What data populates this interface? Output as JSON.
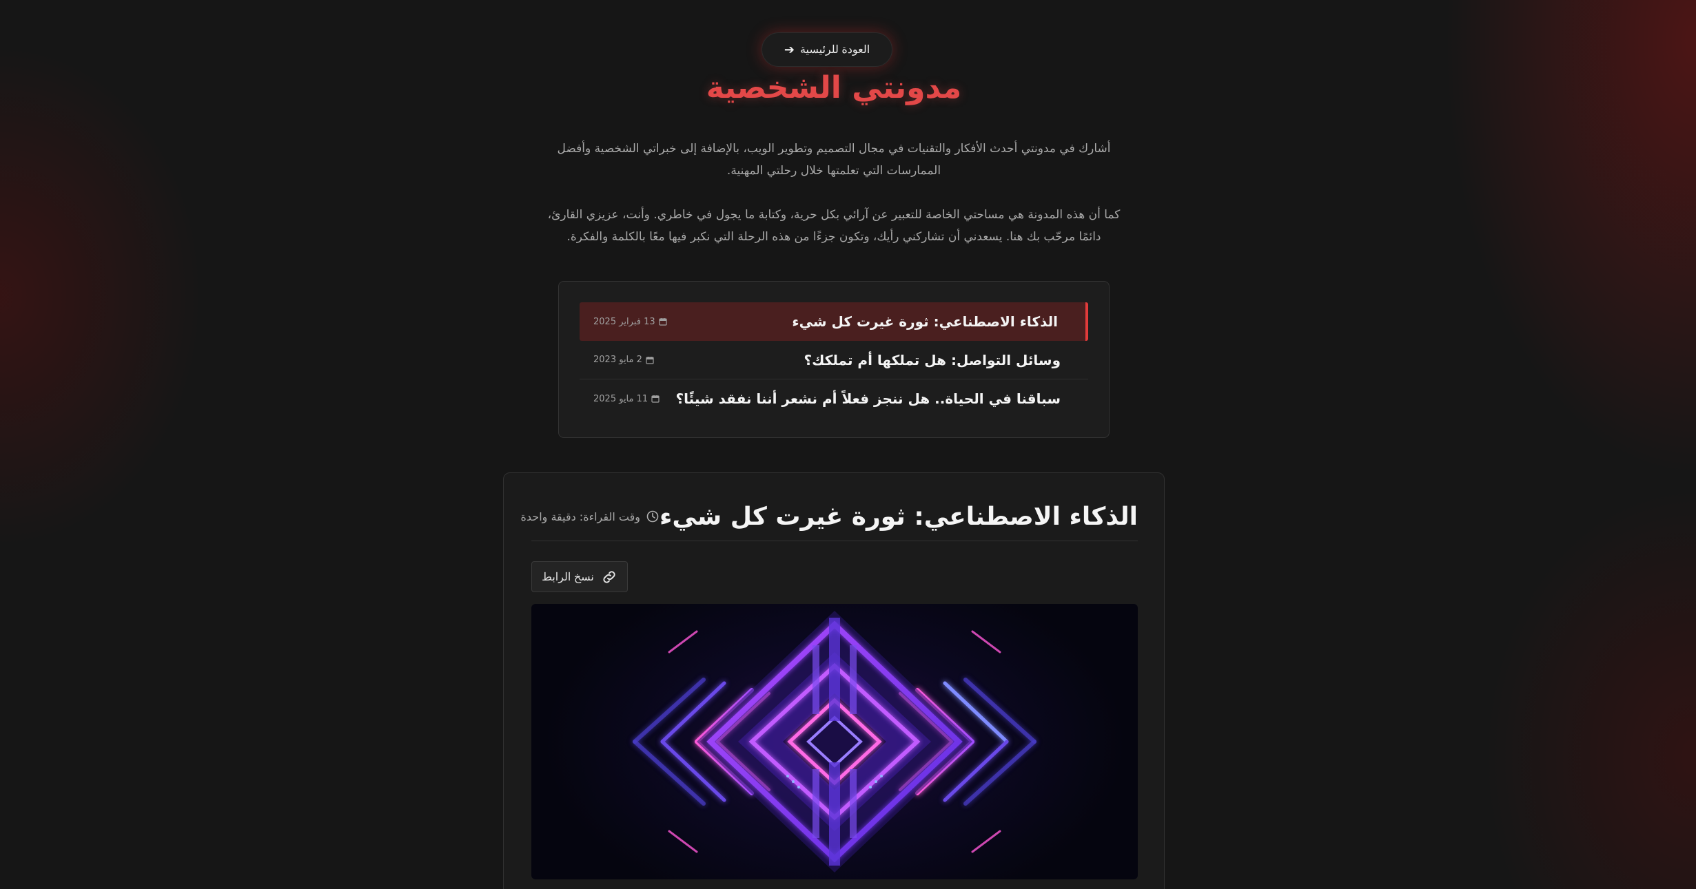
{
  "header": {
    "back_button_label": "العودة للرئيسية",
    "site_title": "مدونتي الشخصية",
    "intro_paragraph_1": "أشارك في مدونتي أحدث الأفكار والتقنيات في مجال التصميم وتطوير الويب، بالإضافة إلى خبراتي الشخصية وأفضل الممارسات التي تعلمتها خلال رحلتي المهنية.",
    "intro_paragraph_2": "كما أن هذه المدونة هي مساحتي الخاصة للتعبير عن آرائي بكل حرية، وكتابة ما يجول في خاطري. وأنت، عزيزي القارئ، دائمًا مرحّب بك هنا. يسعدني أن تشاركني رأيك، وتكون جزءًا من هذه الرحلة التي نكبر فيها معًا بالكلمة والفكرة."
  },
  "posts": [
    {
      "title": "الذكاء الاصطناعي: ثورة غيرت كل شيء",
      "date": "13 فبراير 2025",
      "active": true
    },
    {
      "title": "وسائل التواصل: هل تملكها أم تملكك؟",
      "date": "2 مايو 2023",
      "active": false
    },
    {
      "title": "سباقنا في الحياة.. هل ننجز فعلاً أم نشعر أننا نفقد شيئًا؟",
      "date": "11 مايو 2025",
      "active": false
    }
  ],
  "article": {
    "title": "الذكاء الاصطناعي: ثورة غيرت كل شيء",
    "reading_time": "وقت القراءة: دقيقة واحدة",
    "copy_link_label": "نسخ الرابط"
  },
  "colors": {
    "accent": "#e34848",
    "active_post_bg": "#4a1f1f",
    "page_bg": "#161616"
  },
  "icons": {
    "back": "arrow-right-icon",
    "date": "calendar-icon",
    "reading": "clock-icon",
    "copy": "link-icon"
  }
}
